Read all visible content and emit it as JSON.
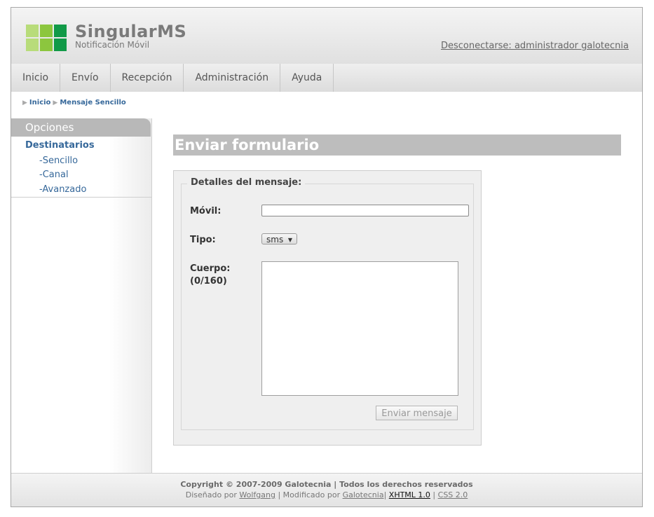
{
  "app": {
    "name": "SingularMS",
    "subtitle": "Notificación Móvil",
    "logout": "Desconectarse: administrador galotecnia",
    "logo_colors": [
      "#b8dc7a",
      "#8cc63e",
      "#119a48",
      "#b8dc7a",
      "#8cc63e",
      "#119a48"
    ]
  },
  "nav": [
    {
      "label": "Inicio"
    },
    {
      "label": "Envío"
    },
    {
      "label": "Recepción"
    },
    {
      "label": "Administración"
    },
    {
      "label": "Ayuda"
    }
  ],
  "breadcrumb": {
    "items": [
      "Inicio",
      "Mensaje Sencillo"
    ]
  },
  "sidebar": {
    "heading": "Opciones",
    "section": "Destinatarios",
    "links": [
      "-Sencillo",
      "-Canal",
      "-Avanzado"
    ]
  },
  "page": {
    "title": "Enviar formulario"
  },
  "form": {
    "legend": "Detalles del mensaje:",
    "movil_label": "Móvil:",
    "movil_value": "",
    "tipo_label": "Tipo:",
    "tipo_value": "sms",
    "cuerpo_label": "Cuerpo:",
    "cuerpo_counter": "(0/160)",
    "submit": "Enviar mensaje"
  },
  "footer": {
    "line1": "Copyright © 2007-2009 Galotecnia | Todos los derechos reservados",
    "designed_by_prefix": "Diseñado por",
    "designed_by": "Wolfgang",
    "modified_by_prefix": "| Modificado por",
    "modified_by": "Galotecnia",
    "sep1": "|",
    "xhtml": "XHTML 1.0",
    "sep2": "|",
    "css": "CSS 2.0"
  }
}
